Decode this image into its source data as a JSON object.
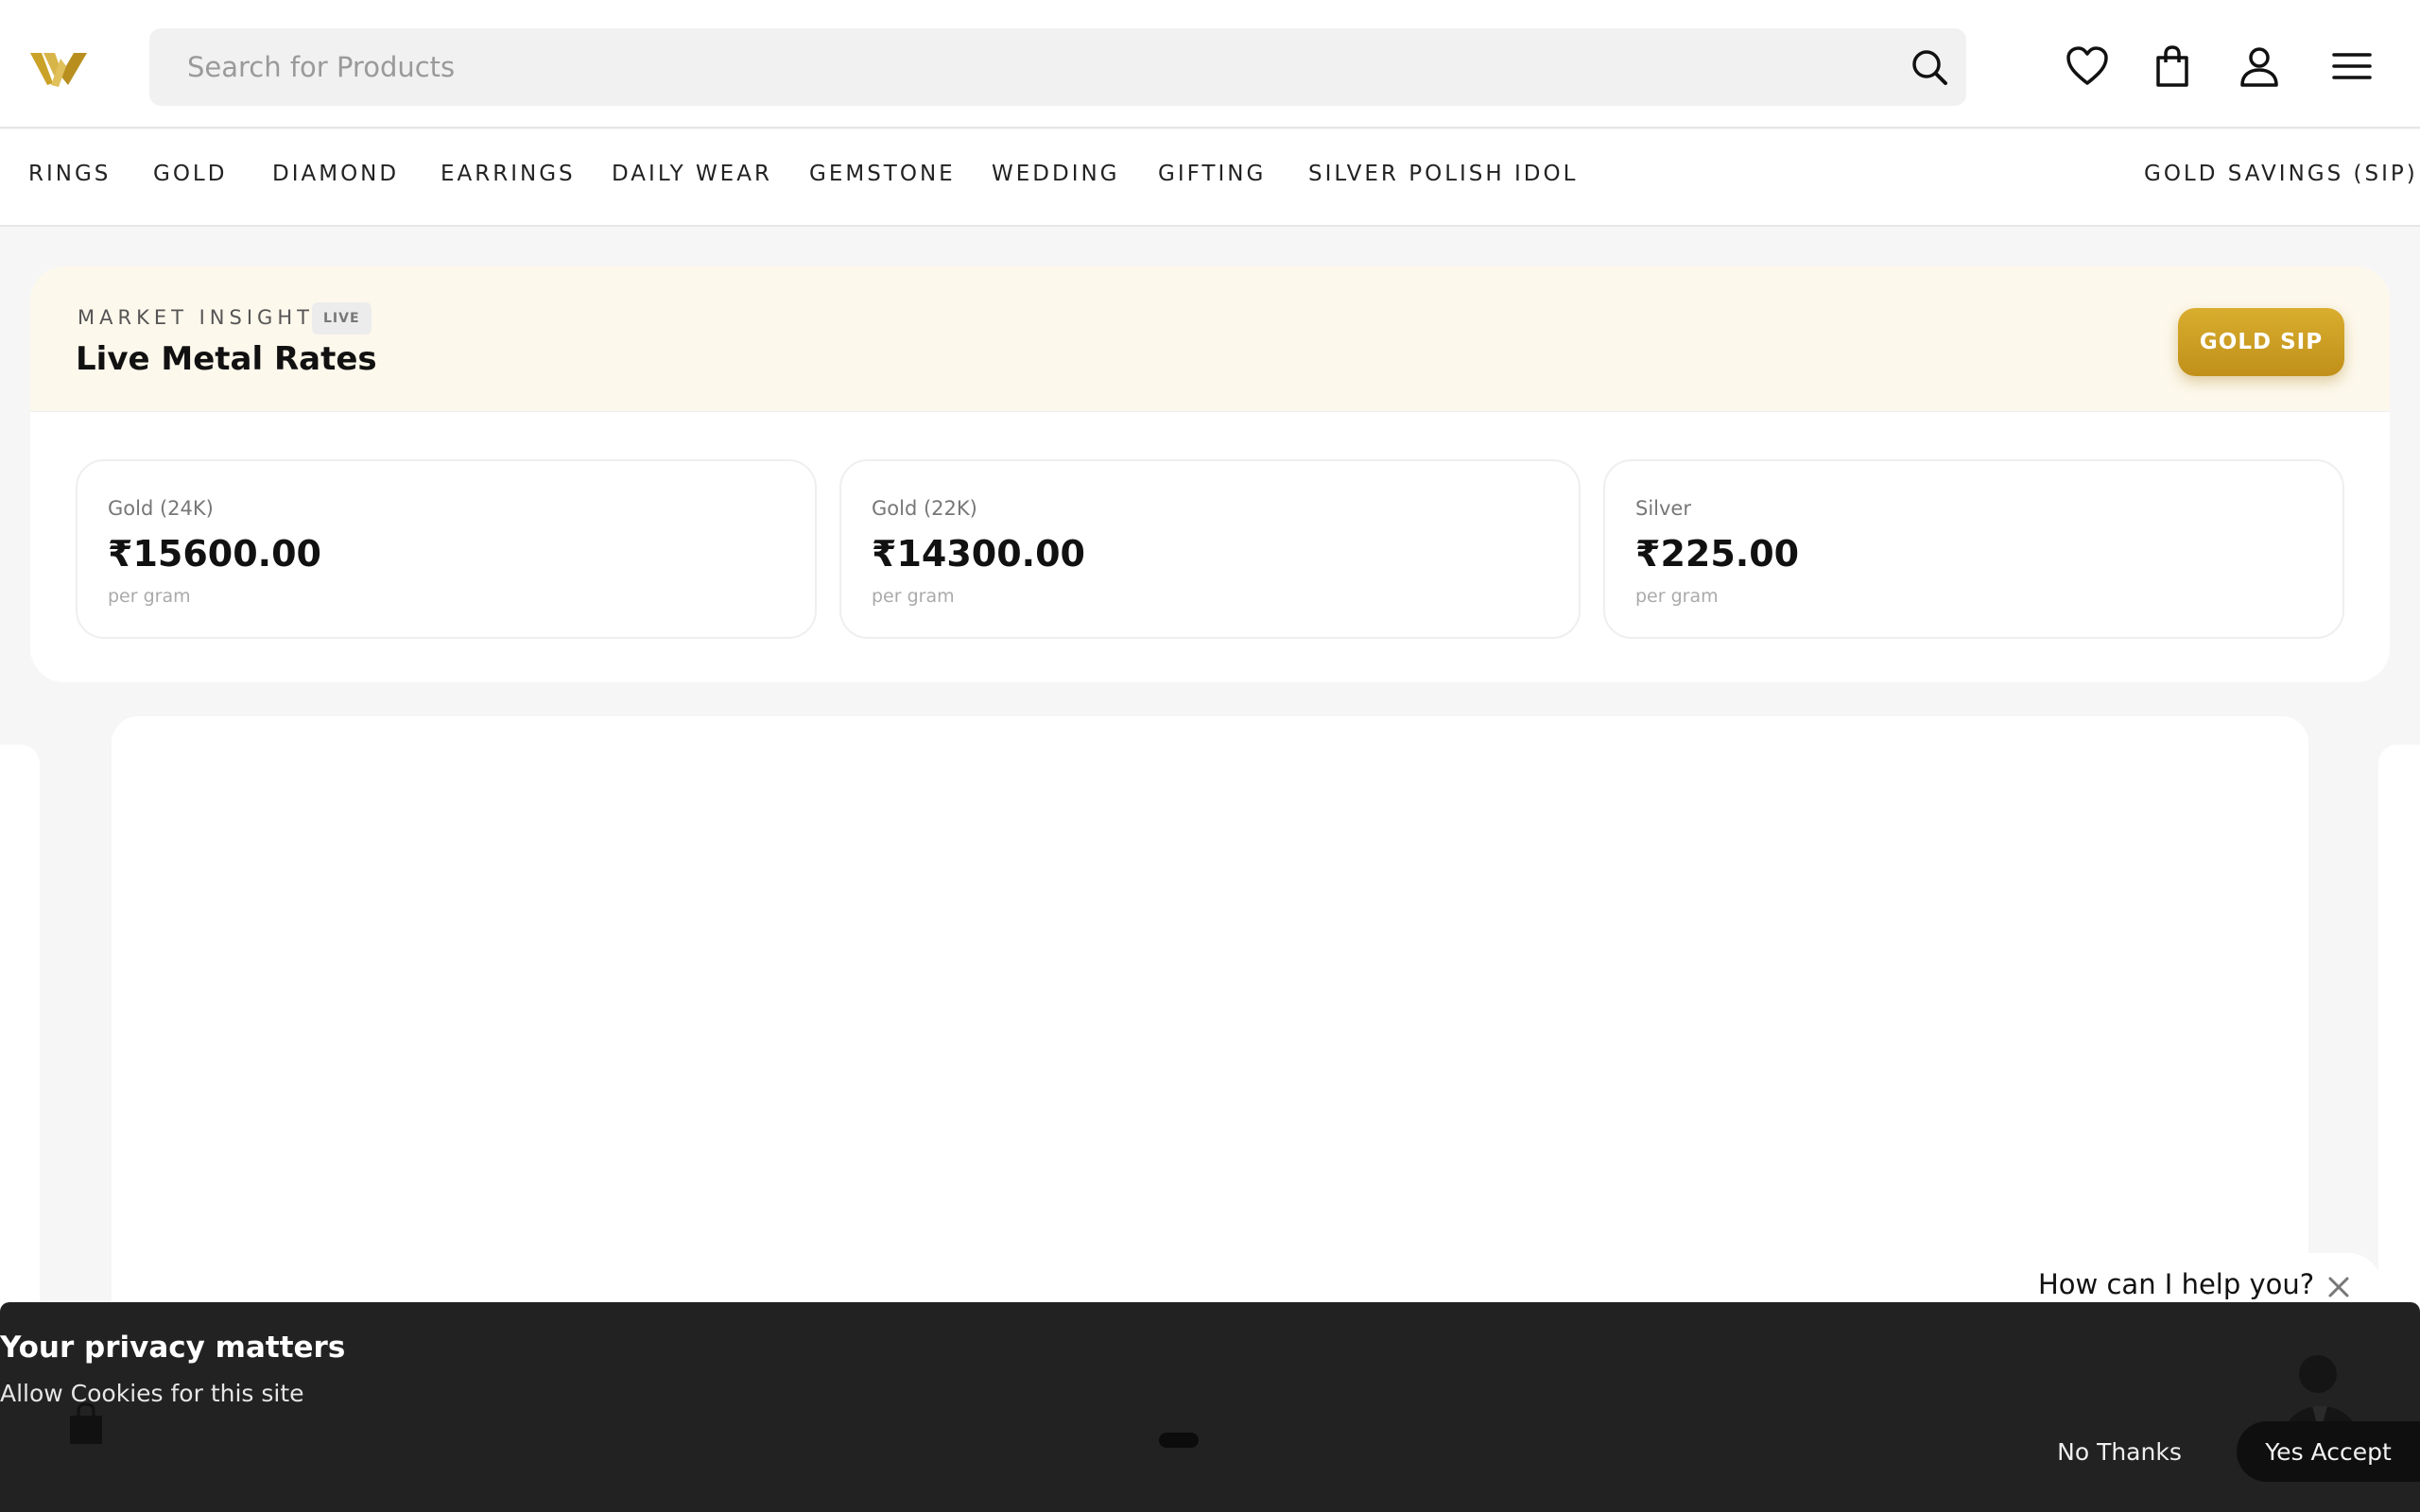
{
  "header": {
    "search_placeholder": "Search for Products",
    "icons": [
      "logo",
      "search-icon",
      "heart-icon",
      "bag-icon",
      "user-icon",
      "menu-icon"
    ]
  },
  "nav": {
    "categories": [
      "RINGS",
      "GOLD",
      "DIAMOND",
      "EARRINGS",
      "DAILY WEAR",
      "GEMSTONE",
      "WEDDING",
      "GIFTING",
      "SILVER POLISH IDOL"
    ],
    "right_link": "GOLD SAVINGS (SIP)"
  },
  "rates": {
    "eyebrow": "MARKET INSIGHTS",
    "badge": "LIVE",
    "title": "Live Metal Rates",
    "button": "GOLD SIP",
    "cards": [
      {
        "name": "Gold (24K)",
        "value": "₹15600.00",
        "unit": "per gram"
      },
      {
        "name": "Gold (22K)",
        "value": "₹14300.00",
        "unit": "per gram"
      },
      {
        "name": "Silver",
        "value": "₹225.00",
        "unit": "per gram"
      }
    ]
  },
  "help": {
    "text": "How can I help you?"
  },
  "cookie": {
    "title": "Your privacy matters",
    "subtitle": "Allow Cookies for this site",
    "decline": "No Thanks",
    "accept": "Yes Accept"
  },
  "colors": {
    "gold": "#c9a227",
    "gold_button": "#d0a11f",
    "cookie_bg": "#222222",
    "rates_header_bg": "#fdf8ec"
  }
}
